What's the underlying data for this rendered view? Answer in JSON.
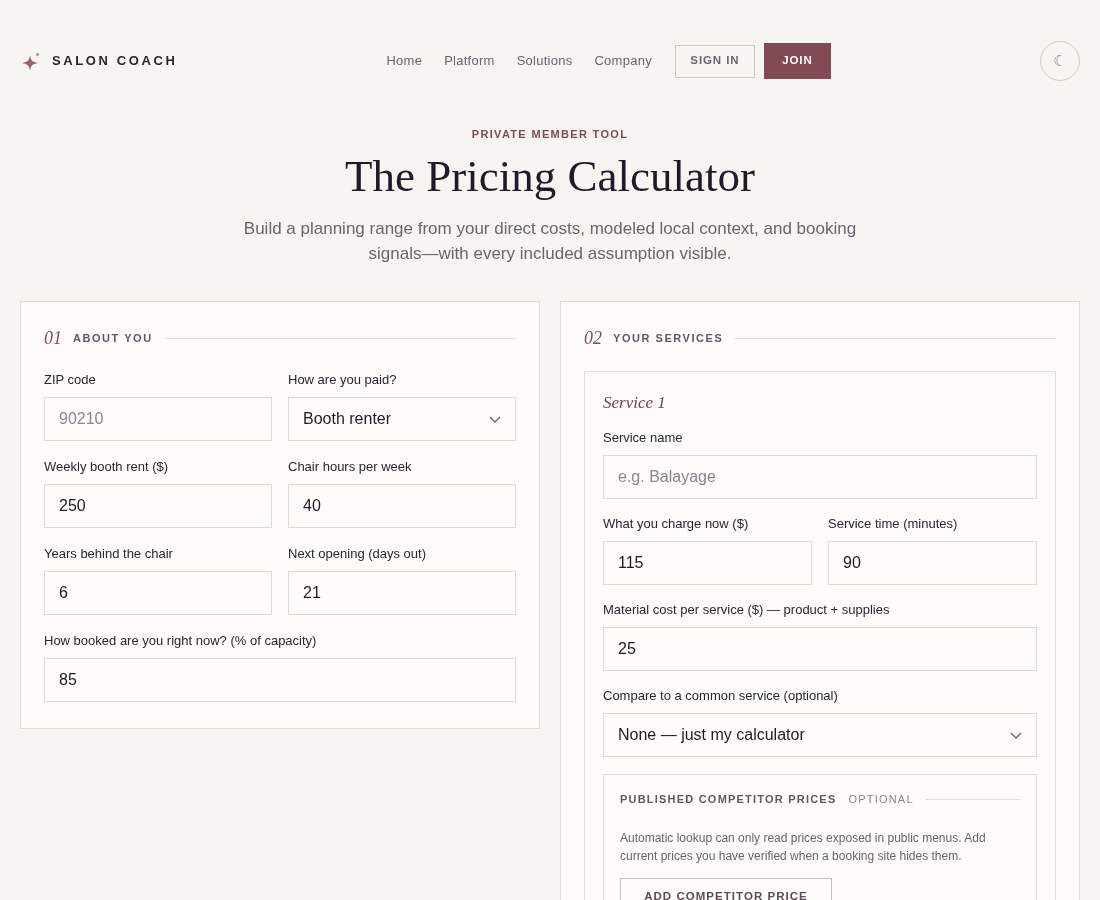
{
  "header": {
    "brand": "SALON COACH",
    "nav": [
      {
        "label": "Home"
      },
      {
        "label": "Platform"
      },
      {
        "label": "Solutions"
      },
      {
        "label": "Company"
      }
    ],
    "sign_in": "SIGN IN",
    "join": "JOIN",
    "theme_toggle": "☾"
  },
  "hero": {
    "eyebrow": "PRIVATE MEMBER TOOL",
    "title": "The Pricing Calculator",
    "subtitle": "Build a planning range from your direct costs, modeled local context, and booking signals—with every included assumption visible."
  },
  "about": {
    "number": "01",
    "title": "ABOUT YOU",
    "rows": [
      [
        {
          "label": "ZIP code",
          "kind": "text",
          "placeholder": "90210"
        },
        {
          "label": "How are you paid?",
          "kind": "select",
          "value": "Booth renter"
        }
      ],
      [
        {
          "label": "Weekly booth rent ($)",
          "kind": "text",
          "value": "250"
        },
        {
          "label": "Chair hours per week",
          "kind": "text",
          "value": "40"
        }
      ],
      [
        {
          "label": "Years behind the chair",
          "kind": "text",
          "value": "6"
        },
        {
          "label": "Next opening (days out)",
          "kind": "text",
          "value": "21"
        }
      ],
      [
        {
          "label": "How booked are you right now? (% of capacity)",
          "kind": "text",
          "value": "85"
        }
      ]
    ]
  },
  "services": {
    "number": "02",
    "title": "YOUR SERVICES",
    "service": {
      "title": "Service 1",
      "rows": [
        [
          {
            "label": "Service name",
            "kind": "text",
            "placeholder": "e.g. Balayage"
          }
        ],
        [
          {
            "label": "What you charge now ($)",
            "kind": "text",
            "value": "115"
          },
          {
            "label": "Service time (minutes)",
            "kind": "text",
            "value": "90"
          }
        ],
        [
          {
            "label": "Material cost per service ($) — product + supplies",
            "kind": "text",
            "value": "25"
          }
        ],
        [
          {
            "label": "Compare to a common service (optional)",
            "kind": "select",
            "value": "None — just my calculator"
          }
        ]
      ],
      "competitor": {
        "title": "PUBLISHED COMPETITOR PRICES",
        "tag": "OPTIONAL",
        "note": "Automatic lookup can only read prices exposed in public menus. Add current prices you have verified when a booking site hides them.",
        "button": "ADD COMPETITOR PRICE"
      }
    }
  }
}
